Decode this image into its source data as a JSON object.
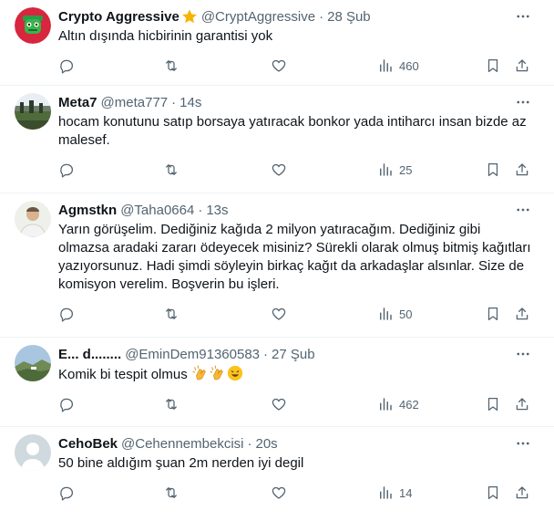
{
  "colors": {
    "text": "#0f1419",
    "secondary": "#536471",
    "border": "#eff3f4"
  },
  "tweets": [
    {
      "name": "Crypto Aggressive",
      "handle": "@CryptAggressive",
      "separator": "·",
      "time": "28 Şub",
      "text": "Altın dışında hicbirinin garantisi yok",
      "views": "460",
      "avatar_icon": "green-frog-avatar",
      "badge_icon": "star-icon"
    },
    {
      "name": "Meta7",
      "handle": "@meta777",
      "separator": "·",
      "time": "14s",
      "text": "hocam konutunu satıp borsaya yatıracak bonkor yada intiharcı insan bizde az malesef.",
      "views": "25",
      "avatar_icon": "landscape-photo-avatar"
    },
    {
      "name": "Agmstkn",
      "handle": "@Taha0664",
      "separator": "·",
      "time": "13s",
      "text": "Yarın görüşelim. Dediğiniz kağıda 2 milyon yatıracağım. Dediğiniz gibi olmazsa aradaki zararı ödeyecek misiniz? Sürekli olarak olmuş bitmiş kağıtları yazıyorsunuz. Hadi şimdi söyleyin birkaç kağıt da arkadaşlar alsınlar. Size de komisyon verelim. Boşverin bu işleri.",
      "views": "50",
      "avatar_icon": "person-photo-avatar"
    },
    {
      "name": "E... d........",
      "handle": "@EminDem91360583",
      "separator": "·",
      "time": "27 Şub",
      "text": "Komik bi tespit olmus",
      "views": "462",
      "avatar_icon": "landscape-photo-avatar",
      "emojis": [
        "clapping-hands-emoji",
        "clapping-hands-emoji",
        "grinning-face-emoji"
      ]
    },
    {
      "name": "CehoBek",
      "handle": "@Cehennembekcisi",
      "separator": "·",
      "time": "20s",
      "text": "50 bine aldığım şuan 2m nerden iyi degil",
      "views": "14",
      "avatar_icon": "default-profile-avatar"
    }
  ]
}
